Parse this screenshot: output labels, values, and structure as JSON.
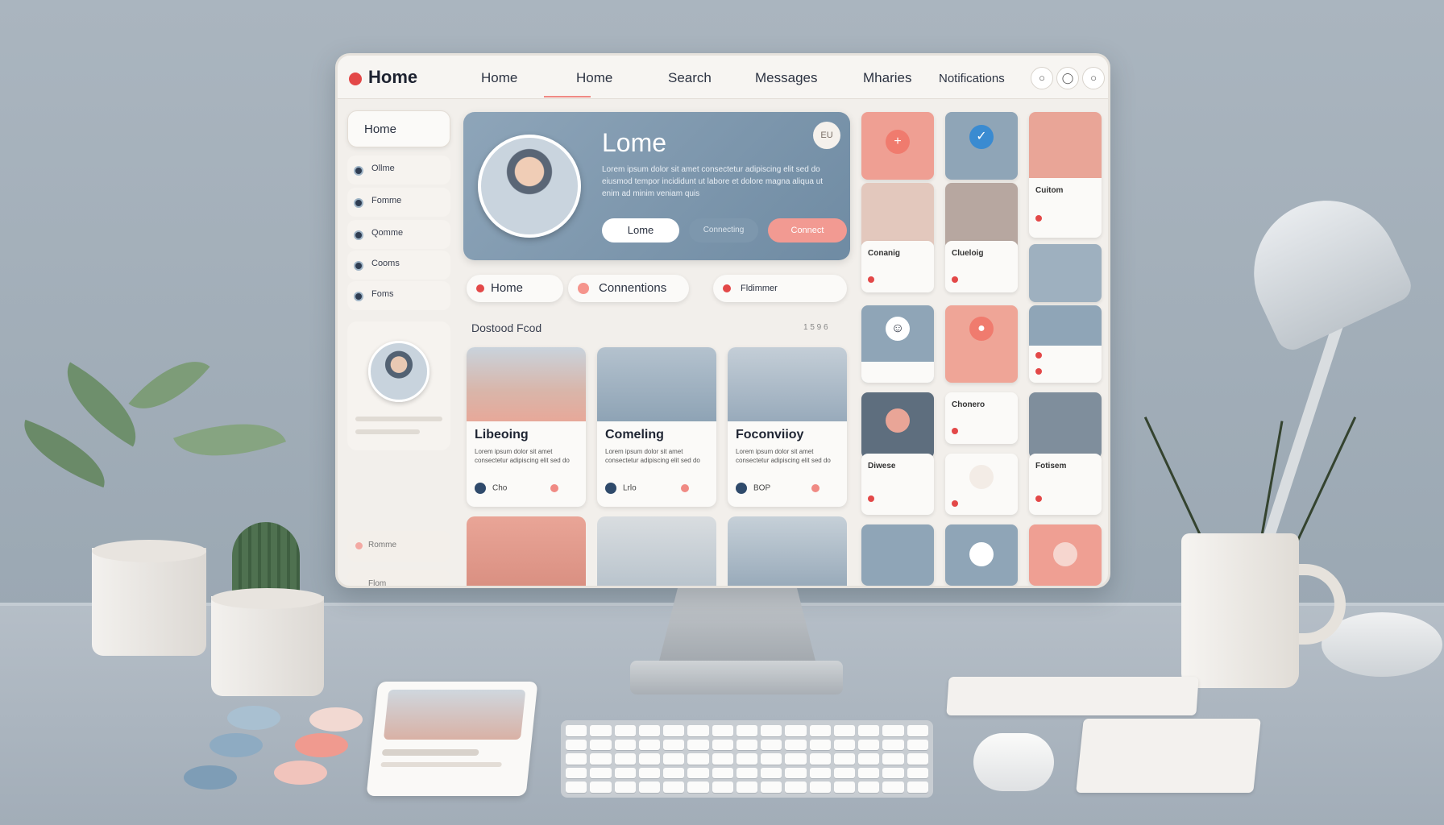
{
  "topbar": {
    "app_title": "Home",
    "nav": [
      "Home",
      "Home",
      "Search",
      "Messages",
      "Mharies",
      "Notifications"
    ],
    "icons": [
      "chat-icon",
      "shield-icon",
      "settings-icon"
    ]
  },
  "sidebar": {
    "home_label": "Home",
    "items": [
      "Ollme",
      "Fomme",
      "Qomme",
      "Cooms",
      "Foms"
    ],
    "bottom_items": [
      "Romme",
      "Flom"
    ]
  },
  "banner": {
    "title": "Lome",
    "text": "Lorem ipsum dolor sit amet consectetur adipiscing elit sed do eiusmod tempor incididunt ut labore et dolore magna aliqua ut enim ad minim veniam quis",
    "button_primary": "Lome",
    "button_secondary": "Connecting",
    "button_accent": "Connect",
    "badge": "EU"
  },
  "tabs": [
    "Home",
    "Connentions",
    "Fldimmer"
  ],
  "feed": {
    "title": "Dostood Fcod",
    "count": "1 5 9 6",
    "cards": [
      {
        "title": "Libeoing",
        "desc": "Lorem ipsum dolor sit amet consectetur adipiscing elit sed do",
        "meta": "Cho"
      },
      {
        "title": "Comeling",
        "desc": "Lorem ipsum dolor sit amet consectetur adipiscing elit sed do",
        "meta": "Lrlo"
      },
      {
        "title": "Foconviioy",
        "desc": "Lorem ipsum dolor sit amet consectetur adipiscing elit sed do",
        "meta": "BOP"
      }
    ]
  },
  "grid": {
    "labels": [
      "Cuitom",
      "Conanig",
      "Clueloig",
      "Chonero",
      "Diwese",
      "Fotisem"
    ]
  },
  "colors": {
    "accent": "#e34848",
    "salmon": "#f29a92",
    "slate": "#7d97ad",
    "background": "#f2efeb"
  }
}
